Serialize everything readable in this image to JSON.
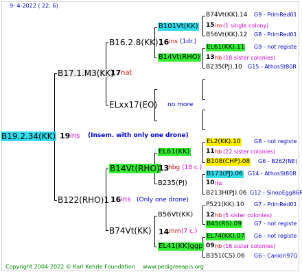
{
  "header": {
    "date": "9-  4-2022 ( 22:  6)"
  },
  "footer": {
    "copyright": "Copyright 2004-2022 © Karl Kehrle Foundation",
    "website": "www.pedigreeapis.org"
  },
  "colors": {
    "cyan": "#33ddee",
    "green": "#33ee33",
    "yellow": "#ffee00",
    "blue": "#0000cc",
    "red": "#cc0000",
    "magenta": "#cc00cc",
    "footer_green": "#008800"
  },
  "nodes": {
    "root": {
      "label": "B19.2.34(KK)",
      "count": "19",
      "unit": "ins",
      "note": "(Insem. with only one drone)"
    },
    "b17": {
      "label": "B17.1.M3(KK)",
      "count": "17",
      "unit": "nat"
    },
    "b16": {
      "label": "B16.2.8(KK)1",
      "count": "16",
      "unit": "ins",
      "note": "(1dr.)"
    },
    "elxx17": {
      "label": "ELxx17(EO)",
      "note": "no more"
    },
    "b122": {
      "label": "B122(RHO)1",
      "count": "16",
      "unit": "ins",
      "note": "(Only one drone)"
    },
    "b14": {
      "label": "B14Vt(RHO)",
      "count": "13",
      "unit": "hbg",
      "note": "(18 c.)"
    },
    "b74": {
      "label": "B74Vt(KK)",
      "count": "16",
      "unit": "ins"
    },
    "el61": {
      "label": "EL61(KK)"
    },
    "b235": {
      "label": "B235(PJ)"
    },
    "b56": {
      "label": "B56Vt(KK)",
      "count": "14",
      "unit": "mm",
      "note": "(7 c.)"
    },
    "el41": {
      "label": "EL41(KK)ggp"
    }
  },
  "level3_left": [
    {
      "label": "B101Vt(KK)",
      "count": "15",
      "unit": "ins",
      "note": "(1 single colony)"
    },
    {
      "label": "B14Vt(RHO)",
      "count": "13",
      "unit": "hb",
      "note": "(18 sister colonies)"
    },
    {
      "label": "EL2(KK)10",
      "count": "11",
      "unit": "hb",
      "note": "(22 sister colonies)"
    },
    {
      "label": "B173(PJ)06",
      "count": "10",
      "unit": "ins"
    },
    {
      "label": "B56Vt(KK)",
      "count": "12",
      "unit": "hb",
      "note": "(5 sister colonies)"
    },
    {
      "label": "EL74(KK)07",
      "count": "09",
      "unit": "hb",
      "note": "(16 sister colonies)"
    }
  ],
  "right_col": [
    {
      "label": "B74Vt(KK).14",
      "ref": "G9 - PrimRed01"
    },
    {
      "label": "B56Vt(KK).12",
      "ref": "G8 - PrimRed01"
    },
    {
      "label": "EL61(KK).11",
      "ref": "G9 - not registe"
    },
    {
      "label": "B235(PJ).10",
      "ref": "G15 - AthosSt80R"
    },
    {
      "label": "EL2(KK).10",
      "ref": "G8 - not registe"
    },
    {
      "label": "B108(CHP).08",
      "ref": "G6 - B262(NE)"
    },
    {
      "label": "B173(PJ).06",
      "ref": "G14 - AthosSt80R"
    },
    {
      "label": "B213H(PJ).06",
      "ref": "G12 - SinopEgg86R"
    },
    {
      "label": "P521(KK).10",
      "ref": "G7 - PrimRed01"
    },
    {
      "label": "B45(RS).09",
      "ref": "G7 - not registe"
    },
    {
      "label": "EL74(KK).07",
      "ref": "G6 - not registe"
    },
    {
      "label": "B351(CS).06",
      "ref": "G6 - Cankiri97Q"
    }
  ]
}
